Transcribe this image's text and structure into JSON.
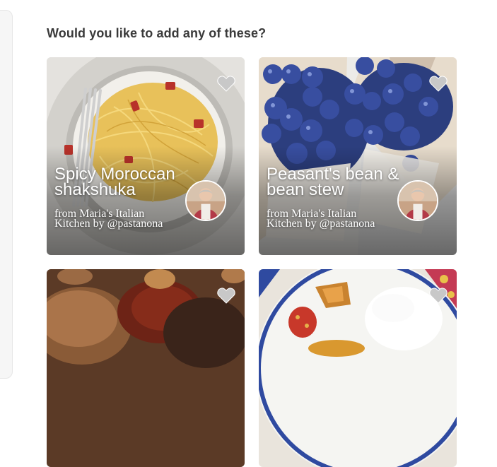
{
  "section": {
    "heading": "Would you like to add any of these?"
  },
  "cards": [
    {
      "title": "Spicy Moroccan shakshuka",
      "subtitle": "from Maria's Italian Kitchen by @pastanona",
      "favorite_icon": "heart-icon",
      "image": "pasta-carbonara-plate"
    },
    {
      "title": "Peasant's bean & bean stew",
      "subtitle": "from Maria's Italian Kitchen by @pastanona",
      "favorite_icon": "heart-icon",
      "image": "blueberry-cheesecake-slices"
    },
    {
      "title": "",
      "subtitle": "",
      "favorite_icon": "heart-icon",
      "image": "braised-meat-dish"
    },
    {
      "title": "",
      "subtitle": "",
      "favorite_icon": "heart-icon",
      "image": "plate-with-cream-and-sides"
    }
  ]
}
